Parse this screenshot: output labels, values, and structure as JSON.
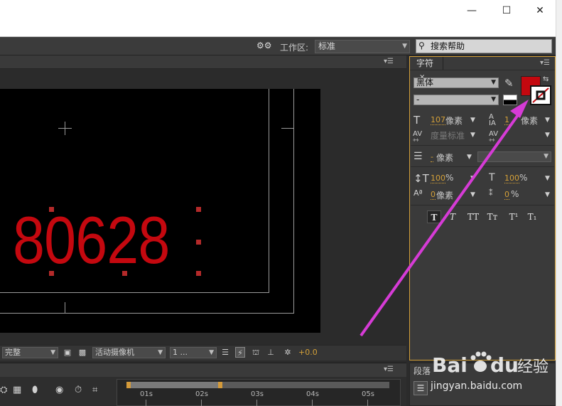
{
  "window": {
    "minimize": "—",
    "maximize": "☐",
    "close": "✕"
  },
  "toolbar": {
    "workspace_label": "工作区:",
    "workspace_value": "标准",
    "search_label": "搜索帮助"
  },
  "composition": {
    "text": "80628",
    "footer": {
      "resolution": "完整",
      "camera": "活动摄像机",
      "views": "1 ...",
      "exposure": "+0.0"
    }
  },
  "timeline": {
    "markers": [
      "01s",
      "02s",
      "03s",
      "04s",
      "05s"
    ]
  },
  "character_panel": {
    "tab": "字符",
    "font_family": "黑体",
    "font_style": "-",
    "fill_color": "#c4080f",
    "font_size": {
      "value": "107",
      "unit": "像素"
    },
    "leading": {
      "value": "1",
      "unit": "像素"
    },
    "kerning": "度量标准",
    "stroke_width": {
      "value": "-",
      "unit": "像素"
    },
    "vertical_scale": {
      "value": "100",
      "unit": "%"
    },
    "horizontal_scale": {
      "value": "100",
      "unit": "%"
    },
    "baseline_shift": {
      "value": "0",
      "unit": "像素"
    },
    "tsume": {
      "value": "0",
      "unit": "%"
    },
    "style_buttons": [
      "T",
      "T",
      "TT",
      "Tт",
      "T¹",
      "T₁"
    ]
  },
  "paragraph_panel": {
    "tab": "段落"
  },
  "watermark": {
    "brand": "Baidu经验",
    "url": "jingyan.baidu.com"
  },
  "colors": {
    "accent_border": "#d4a038",
    "text_red": "#c4080f",
    "annotation_arrow": "#d63bd6"
  }
}
